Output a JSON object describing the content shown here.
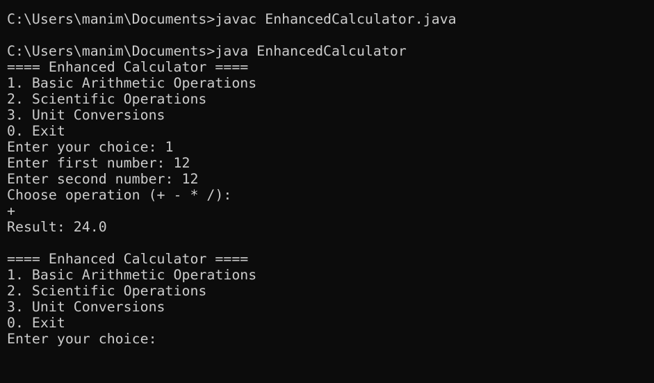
{
  "terminal": {
    "lines": [
      "C:\\Users\\manim\\Documents>javac EnhancedCalculator.java",
      "",
      "C:\\Users\\manim\\Documents>java EnhancedCalculator",
      "==== Enhanced Calculator ====",
      "1. Basic Arithmetic Operations",
      "2. Scientific Operations",
      "3. Unit Conversions",
      "0. Exit",
      "Enter your choice: 1",
      "Enter first number: 12",
      "Enter second number: 12",
      "Choose operation (+ - * /):",
      "+",
      "Result: 24.0",
      "",
      "==== Enhanced Calculator ====",
      "1. Basic Arithmetic Operations",
      "2. Scientific Operations",
      "3. Unit Conversions",
      "0. Exit",
      "Enter your choice: "
    ]
  },
  "colors": {
    "background": "#0c0c0c",
    "foreground": "#cccccc"
  }
}
